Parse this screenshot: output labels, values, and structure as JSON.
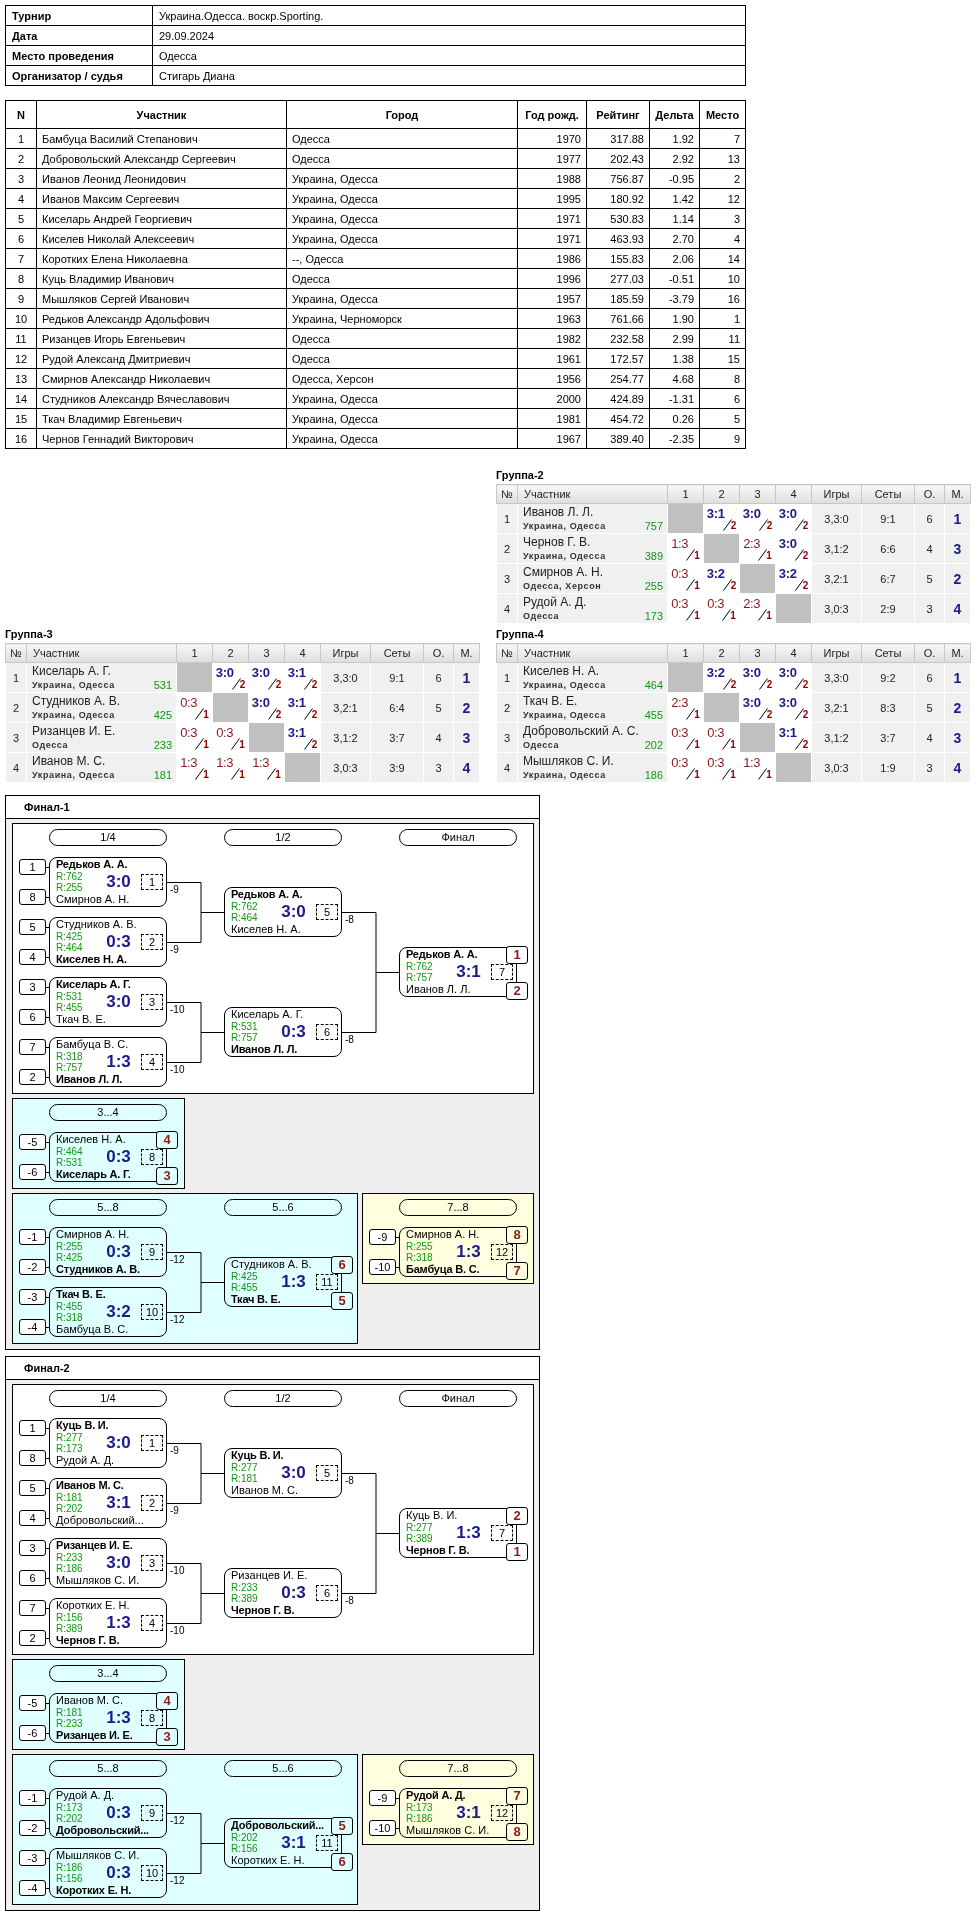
{
  "info": [
    {
      "label": "Турнир",
      "value": "Украина.Одесса. воскр.Sporting."
    },
    {
      "label": "Дата",
      "value": "29.09.2024"
    },
    {
      "label": "Место проведения",
      "value": "Одесса"
    },
    {
      "label": "Организатор / судья",
      "value": "Стигарь Диана"
    }
  ],
  "participants": {
    "columns": [
      "N",
      "Участник",
      "Город",
      "Год рожд.",
      "Рейтинг",
      "Дельта",
      "Место"
    ],
    "rows": [
      [
        "1",
        "Бамбуца Василий Степанович",
        "Одесса",
        "1970",
        "317.88",
        "1.92",
        "7"
      ],
      [
        "2",
        "Добровольский Александр Сергеевич",
        "Одесса",
        "1977",
        "202.43",
        "2.92",
        "13"
      ],
      [
        "3",
        "Иванов Леонид Леонидович",
        "Украина, Одесса",
        "1988",
        "756.87",
        "-0.95",
        "2"
      ],
      [
        "4",
        "Иванов Максим Сергеевич",
        "Украина, Одесса",
        "1995",
        "180.92",
        "1.42",
        "12"
      ],
      [
        "5",
        "Киселарь Андрей Георгиевич",
        "Украина, Одесса",
        "1971",
        "530.83",
        "1.14",
        "3"
      ],
      [
        "6",
        "Киселев Николай Алексеевич",
        "Украина, Одесса",
        "1971",
        "463.93",
        "2.70",
        "4"
      ],
      [
        "7",
        "Коротких Елена Николаевна",
        "--, Одесса",
        "1986",
        "155.83",
        "2.06",
        "14"
      ],
      [
        "8",
        "Куць Владимир Иванович",
        "Одесса",
        "1996",
        "277.03",
        "-0.51",
        "10"
      ],
      [
        "9",
        "Мышляков Сергей Иванович",
        "Украина, Одесса",
        "1957",
        "185.59",
        "-3.79",
        "16"
      ],
      [
        "10",
        "Редьков Александр Адольфович",
        "Украина, Черноморск",
        "1963",
        "761.66",
        "1.90",
        "1"
      ],
      [
        "11",
        "Ризанцев Игорь Евгеньевич",
        "Одесса",
        "1982",
        "232.58",
        "2.99",
        "11"
      ],
      [
        "12",
        "Рудой Александ Дмитриевич",
        "Одесса",
        "1961",
        "172.57",
        "1.38",
        "15"
      ],
      [
        "13",
        "Смирнов Александр Николаевич",
        "Одесса, Херсон",
        "1956",
        "254.77",
        "4.68",
        "8"
      ],
      [
        "14",
        "Студников Александр Вячеславович",
        "Украина, Одесса",
        "2000",
        "424.89",
        "-1.31",
        "6"
      ],
      [
        "15",
        "Ткач Владимир Евгеньевич",
        "Украина, Одесса",
        "1981",
        "454.72",
        "0.26",
        "5"
      ],
      [
        "16",
        "Чернов Геннадий Викторович",
        "Украина, Одесса",
        "1967",
        "389.40",
        "-2.35",
        "9"
      ]
    ]
  },
  "groups": [
    {
      "title": "Группа-2",
      "columns": [
        "№",
        "Участник",
        "1",
        "2",
        "3",
        "4",
        "Игры",
        "Сеты",
        "О.",
        "М."
      ],
      "rows": [
        {
          "n": "1",
          "name": "Иванов Л. Л.",
          "city": "Украина, Одесса",
          "rating": "757",
          "results": [
            {
              "kind": "self"
            },
            {
              "kind": "match",
              "score": "3:1",
              "points": "2",
              "won": true
            },
            {
              "kind": "match",
              "score": "3:0",
              "points": "2",
              "won": true
            },
            {
              "kind": "match",
              "score": "3:0",
              "points": "2",
              "won": true
            }
          ],
          "games": "3,3:0",
          "sets": "9:1",
          "points": "6",
          "place": "1"
        },
        {
          "n": "2",
          "name": "Чернов Г. В.",
          "city": "Украина, Одесса",
          "rating": "389",
          "results": [
            {
              "kind": "match",
              "score": "1:3",
              "points": "1",
              "won": false
            },
            {
              "kind": "self"
            },
            {
              "kind": "match",
              "score": "2:3",
              "points": "1",
              "won": false
            },
            {
              "kind": "match",
              "score": "3:0",
              "points": "2",
              "won": true
            }
          ],
          "games": "3,1:2",
          "sets": "6:6",
          "points": "4",
          "place": "3"
        },
        {
          "n": "3",
          "name": "Смирнов А. Н.",
          "city": "Одесса, Херсон",
          "rating": "255",
          "results": [
            {
              "kind": "match",
              "score": "0:3",
              "points": "1",
              "won": false
            },
            {
              "kind": "match",
              "score": "3:2",
              "points": "2",
              "won": true
            },
            {
              "kind": "self"
            },
            {
              "kind": "match",
              "score": "3:2",
              "points": "2",
              "won": true
            }
          ],
          "games": "3,2:1",
          "sets": "6:7",
          "points": "5",
          "place": "2"
        },
        {
          "n": "4",
          "name": "Рудой А. Д.",
          "city": "Одесса",
          "rating": "173",
          "results": [
            {
              "kind": "match",
              "score": "0:3",
              "points": "1",
              "won": false
            },
            {
              "kind": "match",
              "score": "0:3",
              "points": "1",
              "won": false
            },
            {
              "kind": "match",
              "score": "2:3",
              "points": "1",
              "won": false
            },
            {
              "kind": "self"
            }
          ],
          "games": "3,0:3",
          "sets": "2:9",
          "points": "3",
          "place": "4"
        }
      ]
    },
    {
      "title": "Группа-3",
      "columns": [
        "№",
        "Участник",
        "1",
        "2",
        "3",
        "4",
        "Игры",
        "Сеты",
        "О.",
        "М."
      ],
      "rows": [
        {
          "n": "1",
          "name": "Киселарь А. Г.",
          "city": "Украина, Одесса",
          "rating": "531",
          "results": [
            {
              "kind": "self"
            },
            {
              "kind": "match",
              "score": "3:0",
              "points": "2",
              "won": true
            },
            {
              "kind": "match",
              "score": "3:0",
              "points": "2",
              "won": true
            },
            {
              "kind": "match",
              "score": "3:1",
              "points": "2",
              "won": true
            }
          ],
          "games": "3,3:0",
          "sets": "9:1",
          "points": "6",
          "place": "1"
        },
        {
          "n": "2",
          "name": "Студников А. В.",
          "city": "Украина, Одесса",
          "rating": "425",
          "results": [
            {
              "kind": "match",
              "score": "0:3",
              "points": "1",
              "won": false
            },
            {
              "kind": "self"
            },
            {
              "kind": "match",
              "score": "3:0",
              "points": "2",
              "won": true
            },
            {
              "kind": "match",
              "score": "3:1",
              "points": "2",
              "won": true
            }
          ],
          "games": "3,2:1",
          "sets": "6:4",
          "points": "5",
          "place": "2"
        },
        {
          "n": "3",
          "name": "Ризанцев И. Е.",
          "city": "Одесса",
          "rating": "233",
          "results": [
            {
              "kind": "match",
              "score": "0:3",
              "points": "1",
              "won": false
            },
            {
              "kind": "match",
              "score": "0:3",
              "points": "1",
              "won": false
            },
            {
              "kind": "self"
            },
            {
              "kind": "match",
              "score": "3:1",
              "points": "2",
              "won": true
            }
          ],
          "games": "3,1:2",
          "sets": "3:7",
          "points": "4",
          "place": "3"
        },
        {
          "n": "4",
          "name": "Иванов М. С.",
          "city": "Украина, Одесса",
          "rating": "181",
          "results": [
            {
              "kind": "match",
              "score": "1:3",
              "points": "1",
              "won": false
            },
            {
              "kind": "match",
              "score": "1:3",
              "points": "1",
              "won": false
            },
            {
              "kind": "match",
              "score": "1:3",
              "points": "1",
              "won": false
            },
            {
              "kind": "self"
            }
          ],
          "games": "3,0:3",
          "sets": "3:9",
          "points": "3",
          "place": "4"
        }
      ]
    },
    {
      "title": "Группа-4",
      "columns": [
        "№",
        "Участник",
        "1",
        "2",
        "3",
        "4",
        "Игры",
        "Сеты",
        "О.",
        "М."
      ],
      "rows": [
        {
          "n": "1",
          "name": "Киселев Н. А.",
          "city": "Украина, Одесса",
          "rating": "464",
          "results": [
            {
              "kind": "self"
            },
            {
              "kind": "match",
              "score": "3:2",
              "points": "2",
              "won": true
            },
            {
              "kind": "match",
              "score": "3:0",
              "points": "2",
              "won": true
            },
            {
              "kind": "match",
              "score": "3:0",
              "points": "2",
              "won": true
            }
          ],
          "games": "3,3:0",
          "sets": "9:2",
          "points": "6",
          "place": "1"
        },
        {
          "n": "2",
          "name": "Ткач В. Е.",
          "city": "Украина, Одесса",
          "rating": "455",
          "results": [
            {
              "kind": "match",
              "score": "2:3",
              "points": "1",
              "won": false
            },
            {
              "kind": "self"
            },
            {
              "kind": "match",
              "score": "3:0",
              "points": "2",
              "won": true
            },
            {
              "kind": "match",
              "score": "3:0",
              "points": "2",
              "won": true
            }
          ],
          "games": "3,2:1",
          "sets": "8:3",
          "points": "5",
          "place": "2"
        },
        {
          "n": "3",
          "name": "Добровольский А. С.",
          "city": "Одесса",
          "rating": "202",
          "results": [
            {
              "kind": "match",
              "score": "0:3",
              "points": "1",
              "won": false
            },
            {
              "kind": "match",
              "score": "0:3",
              "points": "1",
              "won": false
            },
            {
              "kind": "self"
            },
            {
              "kind": "match",
              "score": "3:1",
              "points": "2",
              "won": true
            }
          ],
          "games": "3,1:2",
          "sets": "3:7",
          "points": "4",
          "place": "3"
        },
        {
          "n": "4",
          "name": "Мышляков С. И.",
          "city": "Украина, Одесса",
          "rating": "186",
          "results": [
            {
              "kind": "match",
              "score": "0:3",
              "points": "1",
              "won": false
            },
            {
              "kind": "match",
              "score": "0:3",
              "points": "1",
              "won": false
            },
            {
              "kind": "match",
              "score": "1:3",
              "points": "1",
              "won": false
            },
            {
              "kind": "self"
            }
          ],
          "games": "3,0:3",
          "sets": "1:9",
          "points": "3",
          "place": "4"
        }
      ]
    }
  ],
  "finals": [
    {
      "title": "Финал-1",
      "rows": [
        [
          {
            "color": "#ffffff",
            "rounds": [
              {
                "label": "1/4",
                "matches": [
                  {
                    "number": "1",
                    "score": "3:0",
                    "next": "-9",
                    "players": [
                      {
                        "seed": "1",
                        "name": "Редьков А. А.",
                        "rating": "R:762",
                        "winner": true
                      },
                      {
                        "seed": "8",
                        "name": "Смирнов А. Н.",
                        "rating": "R:255",
                        "winner": false
                      }
                    ]
                  },
                  {
                    "number": "2",
                    "score": "0:3",
                    "next": "-9",
                    "players": [
                      {
                        "seed": "5",
                        "name": "Студников А. В.",
                        "rating": "R:425",
                        "winner": false
                      },
                      {
                        "seed": "4",
                        "name": "Киселев Н. А.",
                        "rating": "R:464",
                        "winner": true
                      }
                    ]
                  },
                  {
                    "number": "3",
                    "score": "3:0",
                    "next": "-10",
                    "players": [
                      {
                        "seed": "3",
                        "name": "Киселарь А. Г.",
                        "rating": "R:531",
                        "winner": true
                      },
                      {
                        "seed": "6",
                        "name": "Ткач В. Е.",
                        "rating": "R:455",
                        "winner": false
                      }
                    ]
                  },
                  {
                    "number": "4",
                    "score": "1:3",
                    "next": "-10",
                    "players": [
                      {
                        "seed": "7",
                        "name": "Бамбуца В. С.",
                        "rating": "R:318",
                        "winner": false
                      },
                      {
                        "seed": "2",
                        "name": "Иванов Л. Л.",
                        "rating": "R:757",
                        "winner": true
                      }
                    ]
                  }
                ]
              },
              {
                "label": "1/2",
                "matches": [
                  {
                    "number": "5",
                    "score": "3:0",
                    "next": "-8",
                    "players": [
                      {
                        "name": "Редьков А. А.",
                        "rating": "R:762",
                        "winner": true
                      },
                      {
                        "name": "Киселев Н. А.",
                        "rating": "R:464",
                        "winner": false
                      }
                    ]
                  },
                  {
                    "number": "6",
                    "score": "0:3",
                    "next": "-8",
                    "players": [
                      {
                        "name": "Киселарь А. Г.",
                        "rating": "R:531",
                        "winner": false
                      },
                      {
                        "name": "Иванов Л. Л.",
                        "rating": "R:757",
                        "winner": true
                      }
                    ]
                  }
                ]
              },
              {
                "label": "Финал",
                "matches": [
                  {
                    "number": "7",
                    "score": "3:1",
                    "players": [
                      {
                        "name": "Редьков А. А.",
                        "rating": "R:762",
                        "winner": true,
                        "place": "1"
                      },
                      {
                        "name": "Иванов Л. Л.",
                        "rating": "R:757",
                        "winner": false,
                        "place": "2"
                      }
                    ]
                  }
                ]
              }
            ]
          }
        ],
        [
          {
            "color": "#e0ffff",
            "rounds": [
              {
                "label": "3...4",
                "matches": [
                  {
                    "number": "8",
                    "score": "0:3",
                    "players": [
                      {
                        "seed": "-5",
                        "name": "Киселев Н. А.",
                        "rating": "R:464",
                        "winner": false,
                        "place": "4"
                      },
                      {
                        "seed": "-6",
                        "name": "Киселарь А. Г.",
                        "rating": "R:531",
                        "winner": true,
                        "place": "3"
                      }
                    ]
                  }
                ]
              }
            ]
          }
        ],
        [
          {
            "color": "#e0ffff",
            "rounds": [
              {
                "label": "5...8",
                "matches": [
                  {
                    "number": "9",
                    "score": "0:3",
                    "next": "-12",
                    "players": [
                      {
                        "seed": "-1",
                        "name": "Смирнов А. Н.",
                        "rating": "R:255",
                        "winner": false
                      },
                      {
                        "seed": "-2",
                        "name": "Студников А. В.",
                        "rating": "R:425",
                        "winner": true
                      }
                    ]
                  },
                  {
                    "number": "10",
                    "score": "3:2",
                    "next": "-12",
                    "players": [
                      {
                        "seed": "-3",
                        "name": "Ткач В. Е.",
                        "rating": "R:455",
                        "winner": true
                      },
                      {
                        "seed": "-4",
                        "name": "Бамбуца В. С.",
                        "rating": "R:318",
                        "winner": false
                      }
                    ]
                  }
                ]
              },
              {
                "label": "5...6",
                "matches": [
                  {
                    "number": "11",
                    "score": "1:3",
                    "players": [
                      {
                        "name": "Студников А. В.",
                        "rating": "R:425",
                        "winner": false,
                        "place": "6"
                      },
                      {
                        "name": "Ткач В. Е.",
                        "rating": "R:455",
                        "winner": true,
                        "place": "5"
                      }
                    ]
                  }
                ]
              }
            ]
          },
          {
            "color": "#ffffe0",
            "rounds": [
              {
                "label": "7...8",
                "matches": [
                  {
                    "number": "12",
                    "score": "1:3",
                    "players": [
                      {
                        "seed": "-9",
                        "name": "Смирнов А. Н.",
                        "rating": "R:255",
                        "winner": false,
                        "place": "8"
                      },
                      {
                        "seed": "-10",
                        "name": "Бамбуца В. С.",
                        "rating": "R:318",
                        "winner": true,
                        "place": "7"
                      }
                    ]
                  }
                ]
              }
            ]
          }
        ]
      ]
    },
    {
      "title": "Финал-2",
      "rows": [
        [
          {
            "color": "#ffffff",
            "rounds": [
              {
                "label": "1/4",
                "matches": [
                  {
                    "number": "1",
                    "score": "3:0",
                    "next": "-9",
                    "players": [
                      {
                        "seed": "1",
                        "name": "Куць В. И.",
                        "rating": "R:277",
                        "winner": true
                      },
                      {
                        "seed": "8",
                        "name": "Рудой А. Д.",
                        "rating": "R:173",
                        "winner": false
                      }
                    ]
                  },
                  {
                    "number": "2",
                    "score": "3:1",
                    "next": "-9",
                    "players": [
                      {
                        "seed": "5",
                        "name": "Иванов М. С.",
                        "rating": "R:181",
                        "winner": true
                      },
                      {
                        "seed": "4",
                        "name": "Добровольский...",
                        "rating": "R:202",
                        "winner": false
                      }
                    ]
                  },
                  {
                    "number": "3",
                    "score": "3:0",
                    "next": "-10",
                    "players": [
                      {
                        "seed": "3",
                        "name": "Ризанцев И. Е.",
                        "rating": "R:233",
                        "winner": true
                      },
                      {
                        "seed": "6",
                        "name": "Мышляков С. И.",
                        "rating": "R:186",
                        "winner": false
                      }
                    ]
                  },
                  {
                    "number": "4",
                    "score": "1:3",
                    "next": "-10",
                    "players": [
                      {
                        "seed": "7",
                        "name": "Коротких Е. Н.",
                        "rating": "R:156",
                        "winner": false
                      },
                      {
                        "seed": "2",
                        "name": "Чернов Г. В.",
                        "rating": "R:389",
                        "winner": true
                      }
                    ]
                  }
                ]
              },
              {
                "label": "1/2",
                "matches": [
                  {
                    "number": "5",
                    "score": "3:0",
                    "next": "-8",
                    "players": [
                      {
                        "name": "Куць В. И.",
                        "rating": "R:277",
                        "winner": true
                      },
                      {
                        "name": "Иванов М. С.",
                        "rating": "R:181",
                        "winner": false
                      }
                    ]
                  },
                  {
                    "number": "6",
                    "score": "0:3",
                    "next": "-8",
                    "players": [
                      {
                        "name": "Ризанцев И. Е.",
                        "rating": "R:233",
                        "winner": false
                      },
                      {
                        "name": "Чернов Г. В.",
                        "rating": "R:389",
                        "winner": true
                      }
                    ]
                  }
                ]
              },
              {
                "label": "Финал",
                "matches": [
                  {
                    "number": "7",
                    "score": "1:3",
                    "players": [
                      {
                        "name": "Куць В. И.",
                        "rating": "R:277",
                        "winner": false,
                        "place": "2"
                      },
                      {
                        "name": "Чернов Г. В.",
                        "rating": "R:389",
                        "winner": true,
                        "place": "1"
                      }
                    ]
                  }
                ]
              }
            ]
          }
        ],
        [
          {
            "color": "#e0ffff",
            "rounds": [
              {
                "label": "3...4",
                "matches": [
                  {
                    "number": "8",
                    "score": "1:3",
                    "players": [
                      {
                        "seed": "-5",
                        "name": "Иванов М. С.",
                        "rating": "R:181",
                        "winner": false,
                        "place": "4"
                      },
                      {
                        "seed": "-6",
                        "name": "Ризанцев И. Е.",
                        "rating": "R:233",
                        "winner": true,
                        "place": "3"
                      }
                    ]
                  }
                ]
              }
            ]
          }
        ],
        [
          {
            "color": "#e0ffff",
            "rounds": [
              {
                "label": "5...8",
                "matches": [
                  {
                    "number": "9",
                    "score": "0:3",
                    "next": "-12",
                    "players": [
                      {
                        "seed": "-1",
                        "name": "Рудой А. Д.",
                        "rating": "R:173",
                        "winner": false
                      },
                      {
                        "seed": "-2",
                        "name": "Добровольский...",
                        "rating": "R:202",
                        "winner": true
                      }
                    ]
                  },
                  {
                    "number": "10",
                    "score": "0:3",
                    "next": "-12",
                    "players": [
                      {
                        "seed": "-3",
                        "name": "Мышляков С. И.",
                        "rating": "R:186",
                        "winner": false
                      },
                      {
                        "seed": "-4",
                        "name": "Коротких Е. Н.",
                        "rating": "R:156",
                        "winner": true
                      }
                    ]
                  }
                ]
              },
              {
                "label": "5...6",
                "matches": [
                  {
                    "number": "11",
                    "score": "3:1",
                    "players": [
                      {
                        "name": "Добровольский...",
                        "rating": "R:202",
                        "winner": true,
                        "place": "5"
                      },
                      {
                        "name": "Коротких Е. Н.",
                        "rating": "R:156",
                        "winner": false,
                        "place": "6"
                      }
                    ]
                  }
                ]
              }
            ]
          },
          {
            "color": "#ffffe0",
            "rounds": [
              {
                "label": "7...8",
                "matches": [
                  {
                    "number": "12",
                    "score": "3:1",
                    "players": [
                      {
                        "seed": "-9",
                        "name": "Рудой А. Д.",
                        "rating": "R:173",
                        "winner": true,
                        "place": "7"
                      },
                      {
                        "seed": "-10",
                        "name": "Мышляков С. И.",
                        "rating": "R:186",
                        "winner": false,
                        "place": "8"
                      }
                    ]
                  }
                ]
              }
            ]
          }
        ]
      ]
    }
  ]
}
